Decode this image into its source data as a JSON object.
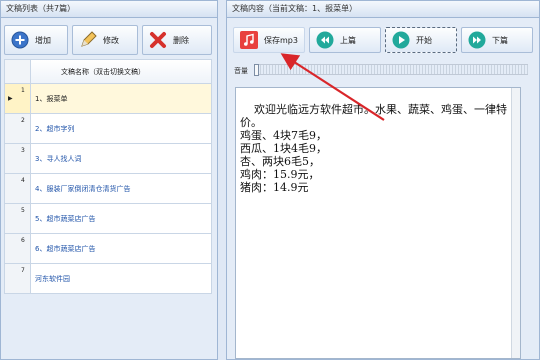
{
  "left": {
    "header": "文稿列表（共7篇）",
    "toolbar": {
      "add_label": "增加",
      "edit_label": "修改",
      "delete_label": "删除"
    },
    "table_header": "文稿名称（双击切换文稿）",
    "rows": [
      {
        "index": "1",
        "name": "1、报菜单",
        "selected": true
      },
      {
        "index": "2",
        "name": "2、超市字列"
      },
      {
        "index": "3",
        "name": "3、寻人找人词"
      },
      {
        "index": "4",
        "name": "4、服装厂家倒闭清仓清货广告"
      },
      {
        "index": "5",
        "name": "5、超市蔬菜店广告"
      },
      {
        "index": "6",
        "name": "6、超市蔬菜店广告"
      },
      {
        "index": "7",
        "name": "河东软件园"
      }
    ]
  },
  "right": {
    "header": "文稿内容（当前文稿：1、报菜单）",
    "toolbar": {
      "save_mp3_label": "保存mp3",
      "prev_label": "上篇",
      "start_label": "开始",
      "next_label": "下篇"
    },
    "volume_label": "音量",
    "volume_level": 0,
    "content": "欢迎光临远方软件超市。水果、蔬菜、鸡蛋、一律特价。\n鸡蛋、4块7毛9，\n西瓜、1块4毛9，\n杏、两块6毛5，\n鸡肉：15.9元，\n猪肉：14.9元"
  },
  "colors": {
    "save_red": "#e8403e",
    "nav_teal": "#21a99b",
    "arrow_red": "#d9262a"
  }
}
